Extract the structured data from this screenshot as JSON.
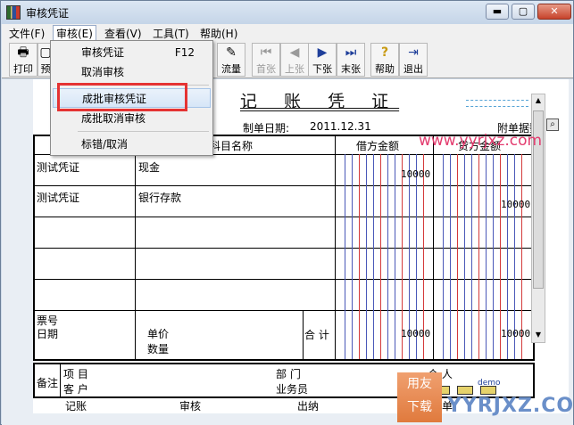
{
  "window": {
    "title": "审核凭证",
    "min": "▬",
    "max": "▢",
    "close": "✕"
  },
  "menu": [
    "文件(F)",
    "审核(E)",
    "查看(V)",
    "工具(T)",
    "帮助(H)"
  ],
  "toolbar": [
    {
      "label": "打印",
      "icon": "printer-icon",
      "glyph": "🖶",
      "enabled": true
    },
    {
      "label": "预",
      "icon": "preview-icon",
      "glyph": "▢",
      "enabled": true
    },
    {
      "label": "流量",
      "icon": "pen-icon",
      "glyph": "✎",
      "enabled": true
    },
    {
      "label": "首张",
      "icon": "first-icon",
      "glyph": "⏮",
      "enabled": false
    },
    {
      "label": "上张",
      "icon": "prev-icon",
      "glyph": "◀",
      "enabled": false
    },
    {
      "label": "下张",
      "icon": "next-icon",
      "glyph": "▶",
      "enabled": true
    },
    {
      "label": "末张",
      "icon": "last-icon",
      "glyph": "⏭",
      "enabled": true
    },
    {
      "label": "帮助",
      "icon": "help-icon",
      "glyph": "?",
      "enabled": true
    },
    {
      "label": "退出",
      "icon": "exit-icon",
      "glyph": "⇥",
      "enabled": true
    }
  ],
  "dropdown": {
    "items": [
      {
        "label": "审核凭证",
        "accel": "F12"
      },
      {
        "label": "取消审核",
        "accel": ""
      },
      {
        "label": "成批审核凭证",
        "accel": "",
        "highlighted": true
      },
      {
        "label": "成批取消审核",
        "accel": ""
      },
      {
        "label": "标错/取消",
        "accel": ""
      }
    ]
  },
  "voucher": {
    "title": "记 账 凭 证",
    "date_label": "制单日期:",
    "date": "2011.12.31",
    "attachments_label": "附单据数:",
    "col_subject": "科目名称",
    "col_debit": "借方金额",
    "col_credit": "贷方金额",
    "rows": [
      {
        "summary": "测试凭证",
        "subject": "现金",
        "debit": "10000",
        "credit": ""
      },
      {
        "summary": "测试凭证",
        "subject": "银行存款",
        "debit": "",
        "credit": "10000"
      }
    ],
    "footer": {
      "ticket_no": "票号",
      "date": "日期",
      "unit_price": "单价",
      "quantity": "数量",
      "total": "合 计",
      "total_debit": "10000",
      "total_credit": "10000"
    },
    "remarks": {
      "label": "备注",
      "project": "项  目",
      "customer": "客  户",
      "department": "部  门",
      "salesperson": "业务员",
      "individual": "个  人"
    },
    "signatures": [
      "记账",
      "审核",
      "出纳",
      "制单"
    ],
    "demo": "demo"
  },
  "watermark": {
    "site": "www.yyrjxz.com",
    "badge_top": "用友",
    "badge_bottom": "下载",
    "site2": "YYRJXZ.COM"
  }
}
